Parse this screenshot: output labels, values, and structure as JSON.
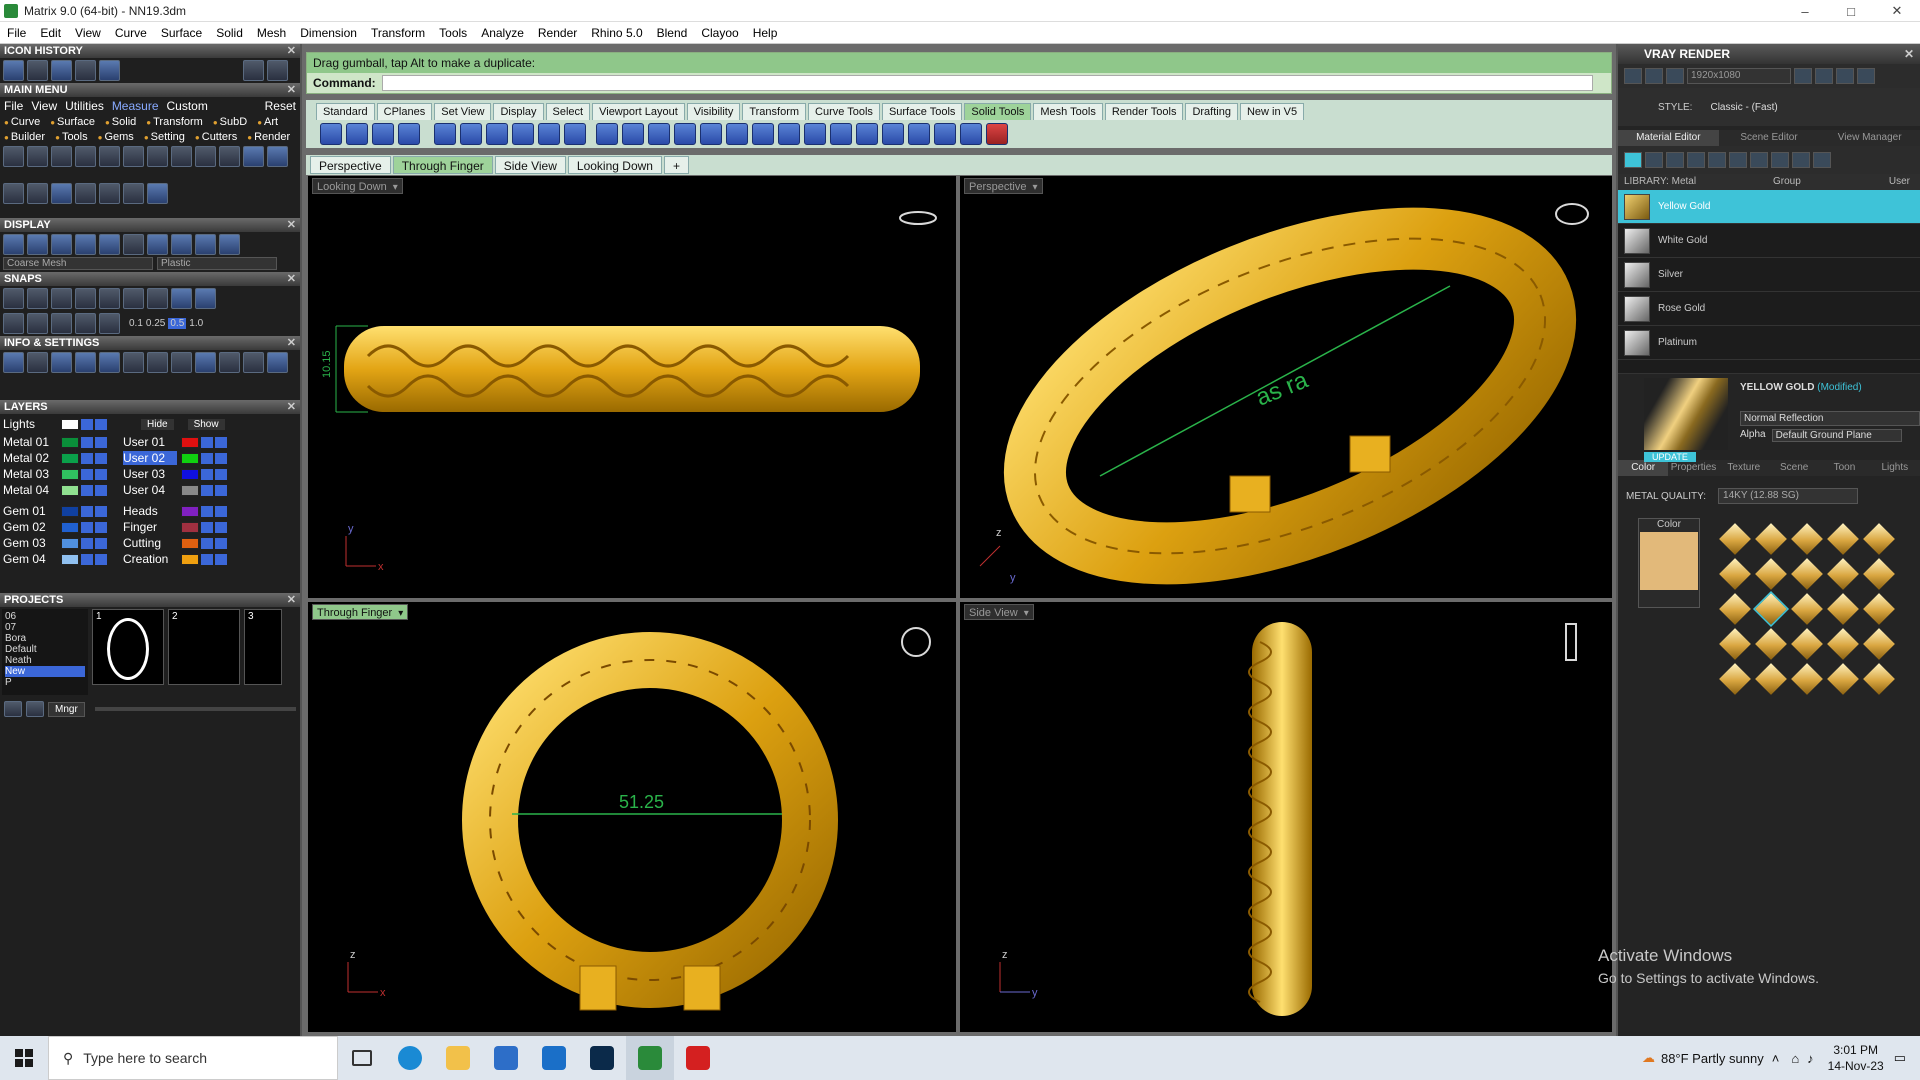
{
  "window": {
    "title": "Matrix 9.0 (64-bit) - NN19.3dm",
    "min": "–",
    "max": "□",
    "close": "✕"
  },
  "menu": [
    "File",
    "Edit",
    "View",
    "Curve",
    "Surface",
    "Solid",
    "Mesh",
    "Dimension",
    "Transform",
    "Tools",
    "Analyze",
    "Render",
    "Rhino 5.0",
    "Blend",
    "Clayoo",
    "Help"
  ],
  "left": {
    "icon_history": "ICON HISTORY",
    "main_menu": "MAIN MENU",
    "mm_row1": [
      "File",
      "View",
      "Utilities",
      "Measure",
      "Custom",
      "Reset"
    ],
    "mm_row2": [
      "Curve",
      "Surface",
      "Solid",
      "Transform",
      "SubD",
      "Art",
      "Builder",
      "Tools",
      "Gems",
      "Setting",
      "Cutters",
      "Render"
    ],
    "display": "DISPLAY",
    "display_mesh": "Coarse Mesh",
    "display_material": "Plastic",
    "snaps": "SNAPS",
    "snap_values": [
      "0.1",
      "0.25",
      "0.5",
      "1.0"
    ],
    "info": "INFO & SETTINGS",
    "layers": "LAYERS",
    "lights": "Lights",
    "hide": "Hide",
    "show": "Show",
    "layer_left": [
      "Metal 01",
      "Metal 02",
      "Metal 03",
      "Metal 04",
      "Gem 01",
      "Gem 02",
      "Gem 03",
      "Gem 04"
    ],
    "layer_right": [
      "User 01",
      "User 02",
      "User 03",
      "User 04",
      "Heads",
      "Finger",
      "Cutting",
      "Creation"
    ],
    "projects": "PROJECTS",
    "project_list": [
      "06",
      "07",
      "Bora",
      "Default",
      "Neath",
      "New",
      "P"
    ],
    "proj_slots": [
      "1",
      "2",
      "3"
    ],
    "mngr": "Mngr"
  },
  "command": {
    "prompt": "Drag gumball, tap Alt to make a duplicate:",
    "label": "Command:"
  },
  "toolbar_tabs": [
    "Standard",
    "CPlanes",
    "Set View",
    "Display",
    "Select",
    "Viewport Layout",
    "Visibility",
    "Transform",
    "Curve Tools",
    "Surface Tools",
    "Solid Tools",
    "Mesh Tools",
    "Render Tools",
    "Drafting",
    "New in V5"
  ],
  "active_tab": "Solid Tools",
  "view_tabs": [
    "Perspective",
    "Through Finger",
    "Side View",
    "Looking Down",
    "+"
  ],
  "viewports": {
    "tl": {
      "label": "Looking Down",
      "dim": "10.15",
      "ax1": "y",
      "ax2": "x"
    },
    "tr": {
      "label": "Perspective",
      "dim": "as ra",
      "ax1": "z",
      "ax2": "y"
    },
    "bl": {
      "label": "Through Finger",
      "dim": "51.25",
      "ax1": "z",
      "ax2": "x"
    },
    "br": {
      "label": "Side View",
      "ax1": "z",
      "ax2": "y"
    }
  },
  "right": {
    "title": "VRAY RENDER",
    "resolution": "1920x1080",
    "style_label": "STYLE:",
    "style_value": "Classic - (Fast)",
    "tabs": [
      "Material Editor",
      "Scene Editor",
      "View Manager"
    ],
    "library": "LIBRARY: Metal",
    "group": "Group",
    "user": "User",
    "materials": [
      "Yellow Gold",
      "White Gold",
      "Silver",
      "Rose Gold",
      "Platinum"
    ],
    "preview_name": "YELLOW GOLD",
    "preview_mod": "(Modified)",
    "update": "UPDATE",
    "reflection": "Normal Reflection",
    "alpha": "Alpha",
    "ground": "Default Ground Plane",
    "color_tabs": [
      "Color",
      "Properties",
      "Texture",
      "Scene",
      "Toon",
      "Lights"
    ],
    "metal_quality_label": "METAL QUALITY:",
    "metal_quality_value": "14KY           (12.88 SG)",
    "color_label": "Color",
    "swatch_color": "#e2b97a"
  },
  "watermark": {
    "line1": "Activate Windows",
    "line2": "Go to Settings to activate Windows."
  },
  "taskbar": {
    "search": "Type here to search",
    "weather": "88°F  Partly sunny",
    "time": "3:01 PM",
    "date": "14-Nov-23"
  }
}
